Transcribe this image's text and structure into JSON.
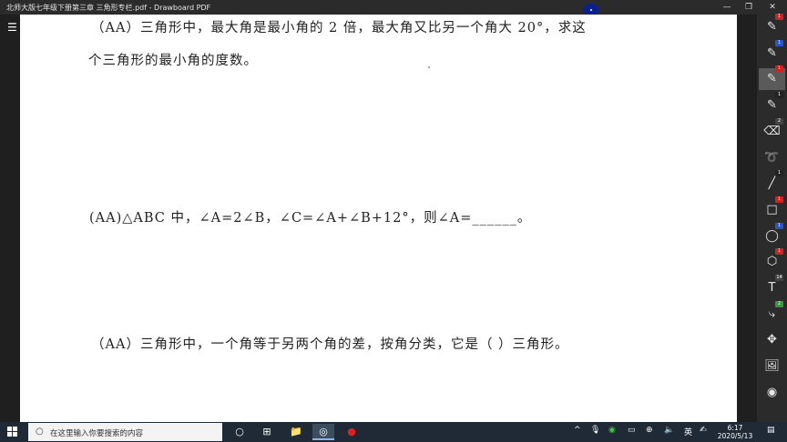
{
  "window": {
    "title": "北师大版七年级下册第三章   三角形专栏.pdf - Drawboard PDF",
    "minimize_icon": "—",
    "restore_icon": "❐",
    "close_icon": "✕"
  },
  "menu": {
    "icon": "☰"
  },
  "document": {
    "q1_line1": "（AA）三角形中，最大角是最小角的 2 倍，最大角又比另一个角大 20°，求这",
    "q1_line2": "个三角形的最小角的度数。",
    "q2": "(AA)△ABC 中，∠A=2∠B，∠C=∠A+∠B+12°，则∠A=______。",
    "q3": "（AA）三角形中，一个角等于另两个角的差，按角分类，它是（    ）三角形。"
  },
  "toolbar": {
    "tools": [
      {
        "name": "pen-tool",
        "glyph": "✎",
        "badge": "1",
        "badge_color": "#d42020"
      },
      {
        "name": "pencil-tool",
        "glyph": "✎",
        "badge": "1",
        "badge_color": "#2a55c8"
      },
      {
        "name": "highlighter-tool",
        "glyph": "✎",
        "badge": "1",
        "badge_color": "#d42020"
      },
      {
        "name": "marker-tool",
        "glyph": "✎",
        "badge": "1",
        "badge_color": "#222222"
      },
      {
        "name": "eraser-tool",
        "glyph": "⌫",
        "badge": "2",
        "badge_color": "#444444"
      },
      {
        "name": "lasso-tool",
        "glyph": "➰",
        "badge": "",
        "badge_color": ""
      },
      {
        "name": "line-tool",
        "glyph": "╱",
        "badge": "1",
        "badge_color": "#222222"
      },
      {
        "name": "rectangle-tool",
        "glyph": "□",
        "badge": "1",
        "badge_color": "#d42020"
      },
      {
        "name": "ellipse-tool",
        "glyph": "◯",
        "badge": "1",
        "badge_color": "#2a55c8"
      },
      {
        "name": "polygon-tool",
        "glyph": "⬡",
        "badge": "1",
        "badge_color": "#d42020"
      },
      {
        "name": "text-tool",
        "glyph": "T",
        "badge": "14",
        "badge_color": "#444444"
      },
      {
        "name": "connector-tool",
        "glyph": "⤷",
        "badge": "2",
        "badge_color": "#2aa02a"
      },
      {
        "name": "move-tool",
        "glyph": "✥",
        "badge": "",
        "badge_color": ""
      },
      {
        "name": "image-tool",
        "glyph": "🖼",
        "badge": "",
        "badge_color": ""
      },
      {
        "name": "more-tool",
        "glyph": "◉",
        "badge": "",
        "badge_color": ""
      }
    ]
  },
  "taskbar": {
    "search_placeholder": "在这里输入你要搜索的内容",
    "search_icon": "○",
    "cortana_icon": "○",
    "taskview_icon": "⊞",
    "explorer_icon": "📁",
    "drawboard_icon": "◎",
    "record_icon": "●",
    "tray_chevron": "^",
    "mic_icon": "🎙",
    "wechat_icon": "◉",
    "display_icon": "▭",
    "network_icon": "⊕",
    "volume_icon": "🔈",
    "ime_label": "英",
    "pen_icon": "✍",
    "time": "6:17",
    "date": "2020/5/13",
    "notification_icon": "▤"
  }
}
